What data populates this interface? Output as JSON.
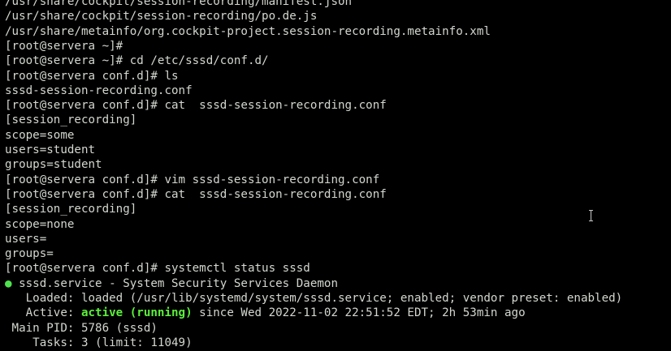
{
  "terminal": {
    "lines": [
      "/usr/share/cockpit/session-recording/manifest.json",
      "/usr/share/cockpit/session-recording/po.de.js",
      "/usr/share/metainfo/org.cockpit-project.session-recording.metainfo.xml",
      "[root@servera ~]#",
      "[root@servera ~]# cd /etc/sssd/conf.d/",
      "[root@servera conf.d]# ls",
      "sssd-session-recording.conf",
      "[root@servera conf.d]# cat  sssd-session-recording.conf",
      "[session_recording]",
      "scope=some",
      "users=student",
      "groups=student",
      "[root@servera conf.d]# vim sssd-session-recording.conf",
      "[root@servera conf.d]# cat  sssd-session-recording.conf",
      "[session_recording]",
      "scope=none",
      "users=",
      "groups=",
      "[root@servera conf.d]# systemctl status sssd"
    ],
    "status": {
      "bullet": "●",
      "unit_line": " sssd.service - System Security Services Daemon",
      "loaded_line": "   Loaded: loaded (/usr/lib/systemd/system/sssd.service; enabled; vendor preset: enabled)",
      "active_prefix": "   Active: ",
      "active_state": "active (running)",
      "active_suffix": " since Wed 2022-11-02 22:51:52 EDT; 2h 53min ago",
      "main_pid_line": " Main PID: 5786 (sssd)",
      "tasks_line": "    Tasks: 3 (limit: 11049)"
    },
    "colors": {
      "background": "#000000",
      "foreground": "#d3d7cf",
      "active_green": "#5cf03a",
      "bullet_green": "#4ee34e"
    }
  }
}
